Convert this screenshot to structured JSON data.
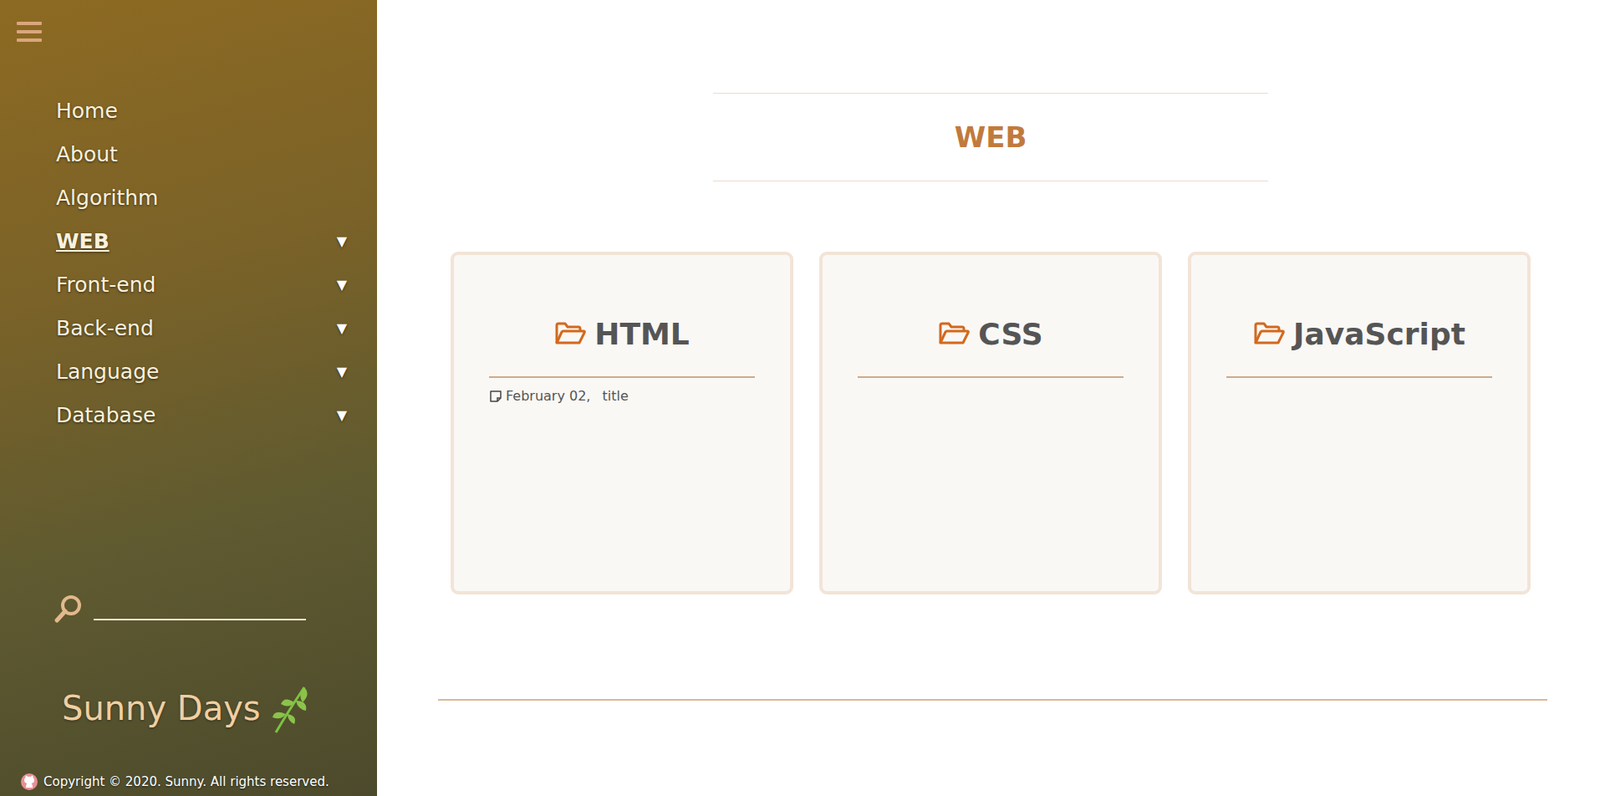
{
  "sidebar": {
    "arrow_glyph": "▼",
    "items": [
      {
        "label": "Home",
        "selected": false,
        "expandable": false
      },
      {
        "label": "About",
        "selected": false,
        "expandable": false
      },
      {
        "label": "Algorithm",
        "selected": false,
        "expandable": false
      },
      {
        "label": "WEB",
        "selected": true,
        "expandable": true
      },
      {
        "label": "Front-end",
        "selected": false,
        "expandable": true
      },
      {
        "label": "Back-end",
        "selected": false,
        "expandable": true
      },
      {
        "label": "Language",
        "selected": false,
        "expandable": true
      },
      {
        "label": "Database",
        "selected": false,
        "expandable": true
      }
    ],
    "brand": "Sunny Days",
    "copyright": "Copyright © 2020. Sunny. All rights reserved."
  },
  "page": {
    "title": "WEB"
  },
  "categories": [
    {
      "name": "HTML",
      "posts": [
        {
          "date": "February 02,",
          "title": "title"
        }
      ]
    },
    {
      "name": "CSS",
      "posts": []
    },
    {
      "name": "JavaScript",
      "posts": []
    }
  ]
}
